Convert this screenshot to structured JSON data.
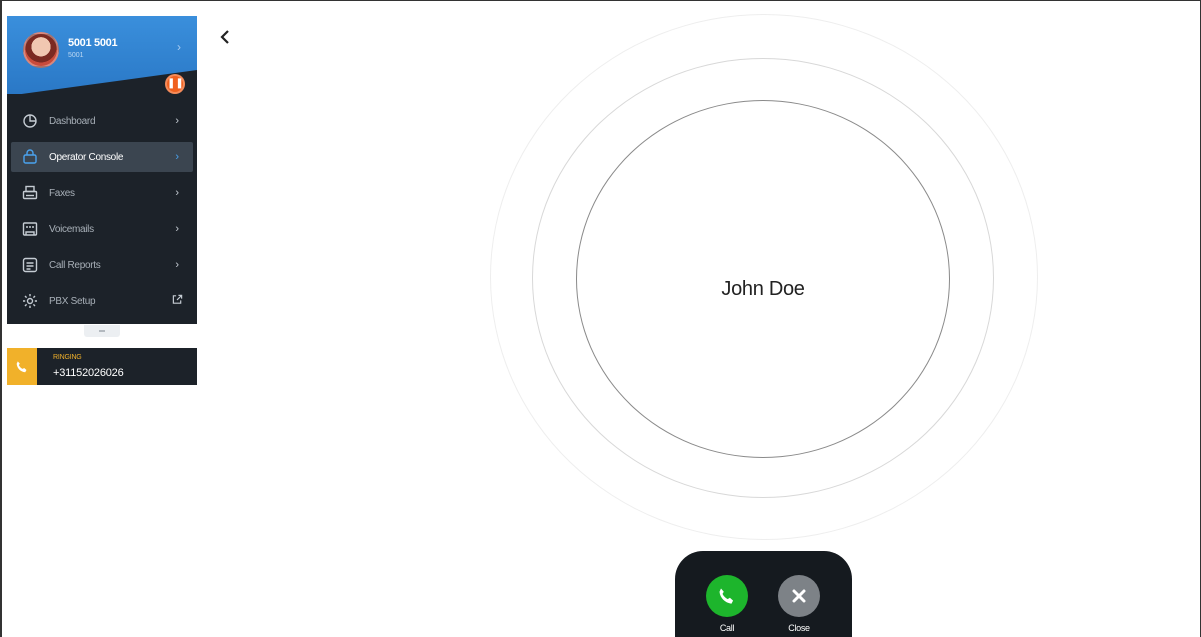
{
  "profile": {
    "name": "5001 5001",
    "extension": "5001",
    "status_badge_icon": "pause-icon"
  },
  "sidebar": {
    "items": [
      {
        "label": "Dashboard",
        "icon": "dashboard-icon",
        "trail": "›"
      },
      {
        "label": "Operator Console",
        "icon": "operator-console-icon",
        "trail": "›",
        "active": true
      },
      {
        "label": "Faxes",
        "icon": "fax-icon",
        "trail": "›"
      },
      {
        "label": "Voicemails",
        "icon": "voicemail-icon",
        "trail": "›"
      },
      {
        "label": "Call Reports",
        "icon": "call-reports-icon",
        "trail": "›"
      },
      {
        "label": "PBX Setup",
        "icon": "gear-icon",
        "trail": "external-link-icon"
      }
    ]
  },
  "ringing": {
    "status": "RINGING",
    "number": "+31152026026"
  },
  "caller": {
    "name": "John Doe"
  },
  "actions": {
    "call_label": "Call",
    "close_label": "Close"
  },
  "colors": {
    "sidebar_bg": "#1c2229",
    "profile_blue": "#2a78c6",
    "call_green": "#1db52c",
    "ringing_amber": "#f1b12a",
    "status_orange": "#f0611f"
  }
}
